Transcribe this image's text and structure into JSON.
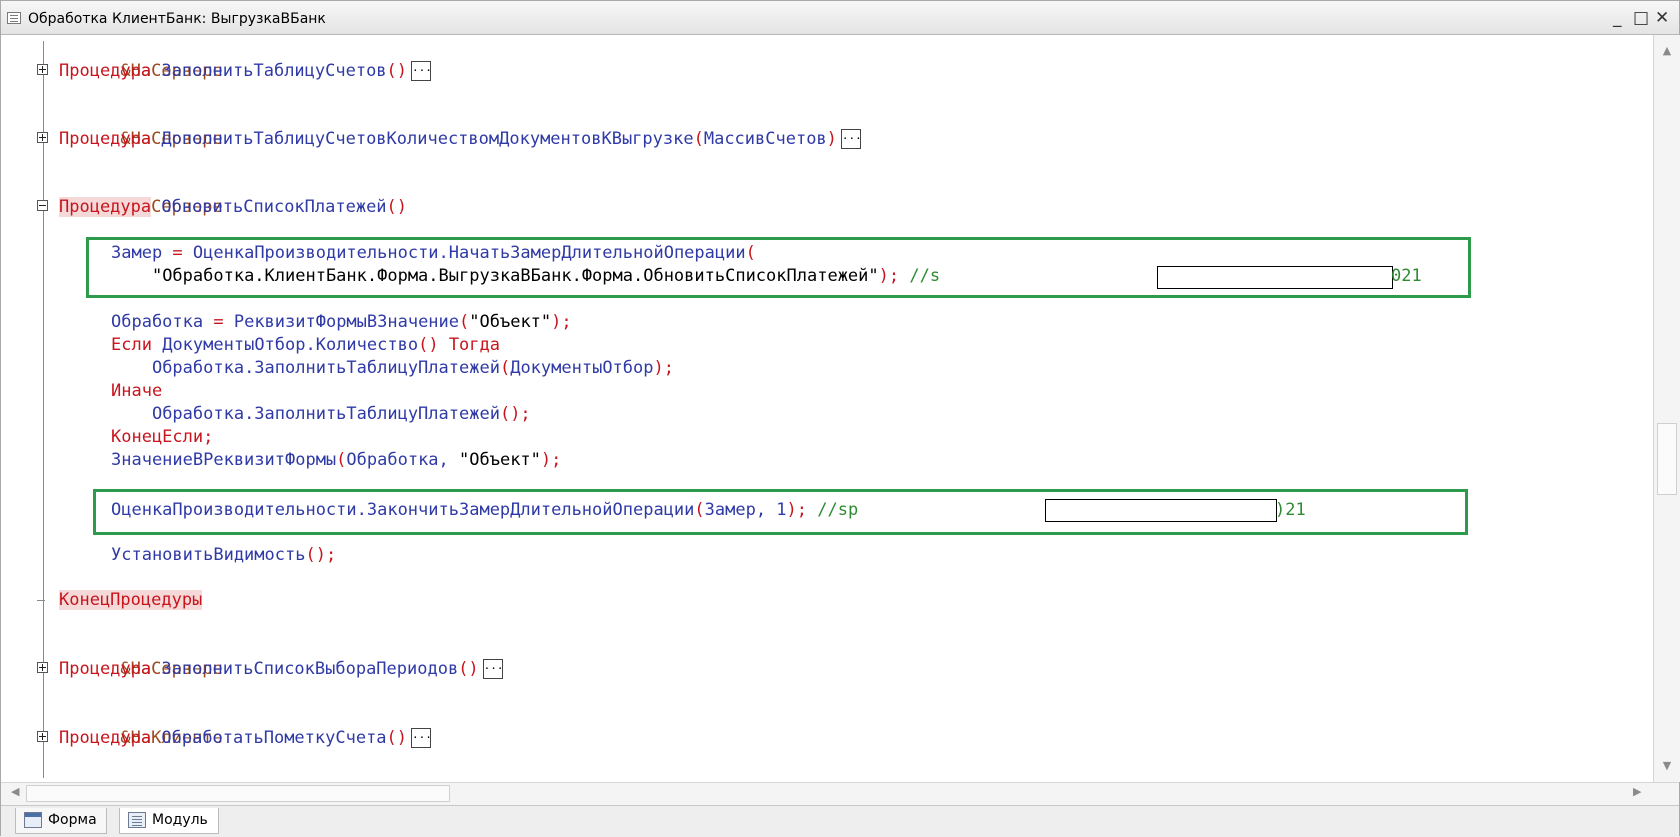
{
  "window": {
    "title": "Обработка КлиентБанк: ВыгрузкаВБанк",
    "controls": {
      "minimize": "_",
      "maximize": "□",
      "close": "✕"
    }
  },
  "code": {
    "l1": {
      "directive": "&НаСервере"
    },
    "l2": {
      "kw": "Процедура",
      "name": "ЗаполнитьТаблицуСчетов",
      "parens": "()",
      "collapsed": "..."
    },
    "l3": {
      "directive": "&НаСервере"
    },
    "l4": {
      "kw": "Процедура",
      "name": "ДополнитьТаблицуСчетовКоличествомДокументовКВыгрузке",
      "open": "(",
      "param": "МассивСчетов",
      "close": ")",
      "collapsed": "..."
    },
    "l5": {
      "directive": "&НаСервере"
    },
    "l6": {
      "kw": "Процедура",
      "name": "ОбновитьСписокПлатежей",
      "parens": "()"
    },
    "l7": {
      "a": "Замер",
      "eq": " = ",
      "b": "ОценкаПроизводительности.НачатьЗамерДлительнойОперации",
      "open": "("
    },
    "l8": {
      "indent": "    ",
      "str": "\"Обработка.КлиентБанк.Форма.ВыгрузкаВБанк.Форма.ОбновитьСписокПлатежей\"",
      "end": "); ",
      "comment": "//s",
      "comment_tail": "021"
    },
    "l9": {
      "a": "Обработка",
      "eq": " = ",
      "b": "РеквизитФормыВЗначение",
      "open": "(",
      "str": "\"Объект\"",
      "end": ");"
    },
    "l10": {
      "kw": "Если",
      "sp": " ",
      "a": "ДокументыОтбор.Количество",
      "p": "()",
      "sp2": " ",
      "kw2": "Тогда"
    },
    "l11": {
      "indent": "    ",
      "a": "Обработка.ЗаполнитьТаблицуПлатежей",
      "open": "(",
      "b": "ДокументыОтбор",
      "end": ");"
    },
    "l12": {
      "kw": "Иначе"
    },
    "l13": {
      "indent": "    ",
      "a": "Обработка.ЗаполнитьТаблицуПлатежей",
      "end": "();"
    },
    "l14": {
      "kw": "КонецЕсли",
      "end": ";"
    },
    "l15": {
      "a": "ЗначениеВРеквизитФормы",
      "open": "(",
      "b": "Обработка, ",
      "str": "\"Объект\"",
      "end": ");"
    },
    "l16": {
      "a": "ОценкаПроизводительности.ЗакончитьЗамерДлительнойОперации",
      "open": "(",
      "b": "Замер, 1",
      "end": "); ",
      "comment": "//sp",
      "comment_tail": ")21"
    },
    "l17": {
      "a": "УстановитьВидимость",
      "end": "();"
    },
    "l18": {
      "kw": "КонецПроцедуры"
    },
    "l19": {
      "directive": "&НаСервере"
    },
    "l20": {
      "kw": "Процедура",
      "name": "ЗаполнитьСписокВыбораПериодов",
      "parens": "()",
      "collapsed": "..."
    },
    "l21": {
      "directive": "&НаКлиенте"
    },
    "l22": {
      "kw": "Процедура",
      "name": "ОбработатьПометкуСчета",
      "parens": "()",
      "collapsed": "..."
    }
  },
  "tabs": [
    {
      "label": "Форма",
      "icon": "form-icon",
      "active": false
    },
    {
      "label": "Модуль",
      "icon": "module-icon",
      "active": true
    }
  ],
  "colors": {
    "directive": "#9b4a1f",
    "keyword": "#c8141d",
    "identifier": "#2f3aa6",
    "comment": "#2f8a32",
    "highlight_box": "#2e9a4c"
  }
}
